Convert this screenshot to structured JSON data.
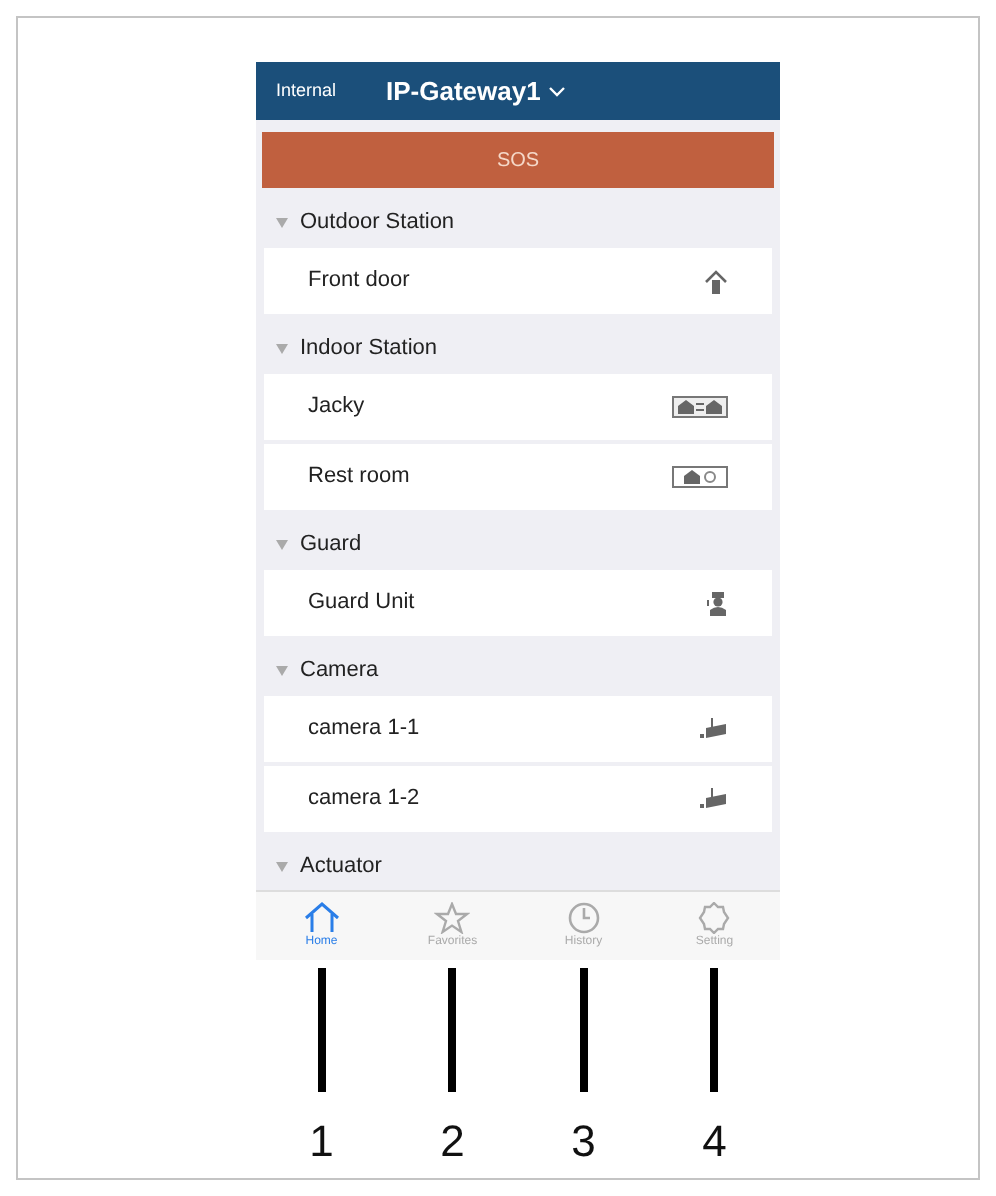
{
  "header": {
    "left_label": "Internal",
    "title": "IP-Gateway1"
  },
  "sos": {
    "label": "SOS"
  },
  "sections": [
    {
      "title": "Outdoor Station",
      "expanded": true,
      "items": [
        {
          "name": "Front door",
          "kind": "door"
        }
      ]
    },
    {
      "title": "Indoor Station",
      "expanded": true,
      "items": [
        {
          "name": "Jacky",
          "kind": "intercom"
        },
        {
          "name": "Rest room",
          "kind": "monitor"
        }
      ]
    },
    {
      "title": "Guard",
      "expanded": true,
      "items": [
        {
          "name": "Guard Unit",
          "kind": "guard"
        }
      ]
    },
    {
      "title": "Camera",
      "expanded": true,
      "items": [
        {
          "name": "camera 1-1",
          "kind": "camera"
        },
        {
          "name": "camera 1-2",
          "kind": "camera"
        }
      ]
    },
    {
      "title": "Actuator",
      "expanded": true
    }
  ],
  "tabs": [
    {
      "label": "Home",
      "kind": "home",
      "selected": true
    },
    {
      "label": "Favorites",
      "kind": "star",
      "selected": false
    },
    {
      "label": "History",
      "kind": "clock",
      "selected": false
    },
    {
      "label": "Setting",
      "kind": "gear",
      "selected": false
    }
  ],
  "callouts": [
    "1",
    "2",
    "3",
    "4"
  ]
}
